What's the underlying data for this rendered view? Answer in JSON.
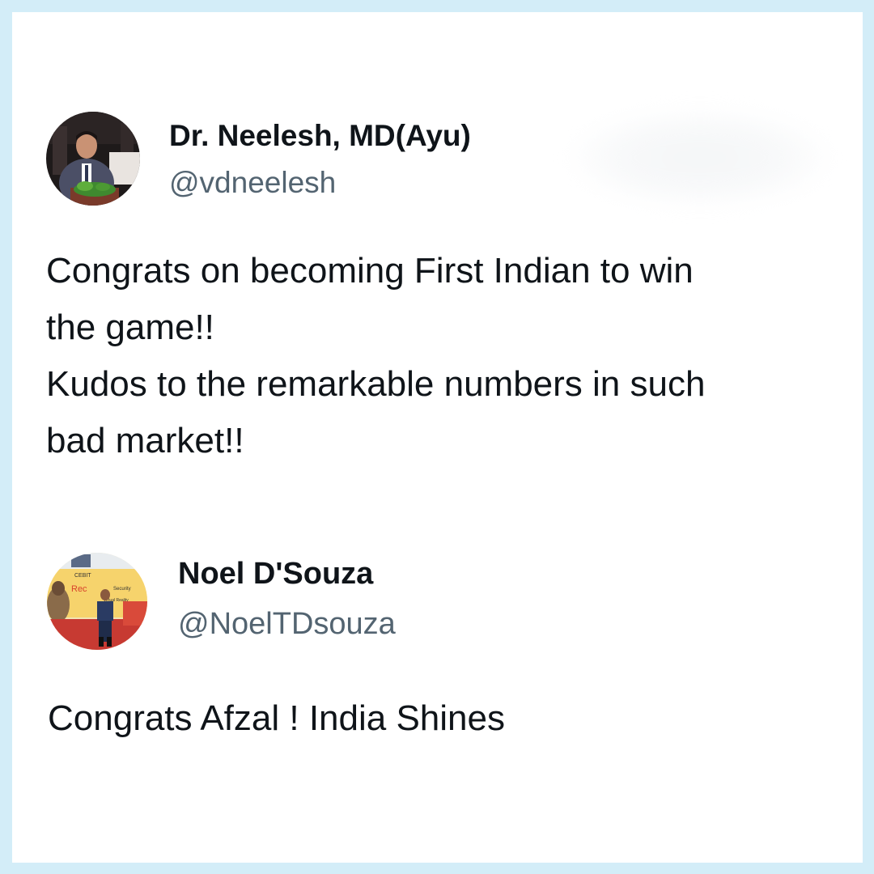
{
  "tweets": [
    {
      "display_name": "Dr. Neelesh, MD(Ayu)",
      "handle": "@vdneelesh",
      "avatar_icon": "person-at-podium-photo",
      "lines": [
        "Congrats on becoming First Indian to win",
        "the game!!",
        "Kudos to the remarkable numbers in such",
        "bad market!!"
      ]
    },
    {
      "display_name": "Noel D'Souza",
      "handle": "@NoelTDsouza",
      "avatar_icon": "person-at-expo-photo",
      "avatar_banner_texts": [
        "CEBIT",
        "Security",
        "Virtual Reality",
        "Rec"
      ],
      "lines": [
        "Congrats Afzal ! India Shines"
      ]
    }
  ],
  "colors": {
    "frame": "#d3edf8",
    "card": "#ffffff",
    "name": "#0f1419",
    "handle": "#536471"
  }
}
